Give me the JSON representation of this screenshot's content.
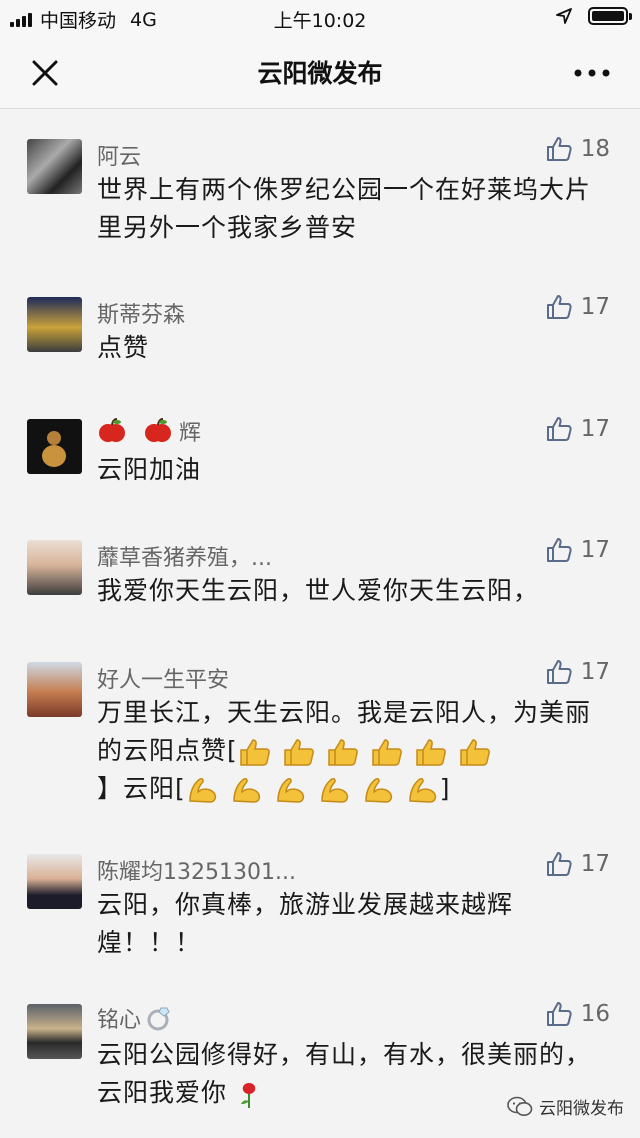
{
  "status_bar": {
    "carrier": "中国移动",
    "network": "4G",
    "time": "上午10:02"
  },
  "nav": {
    "title": "云阳微发布"
  },
  "comments": [
    {
      "name": "阿云",
      "likes": "18",
      "text": "世界上有两个侏罗纪公园一个在好莱坞大片里另外一个我家乡普安"
    },
    {
      "name": "斯蒂芬森",
      "likes": "17",
      "text": "点赞"
    },
    {
      "name": "辉",
      "likes": "17",
      "text": "云阳加油"
    },
    {
      "name": "蘼草香猪养殖，...",
      "likes": "17",
      "text": "我爱你天生云阳，世人爱你天生云阳，"
    },
    {
      "name": "好人一生平安",
      "likes": "17",
      "text_part1": "万里长江，天生云阳。我是云阳人，为美丽的云阳点赞[",
      "text_part2": "】云阳[",
      "text_part3": "]"
    },
    {
      "name": "陈耀均13251301...",
      "likes": "17",
      "text": "云阳，你真棒，旅游业发展越来越辉煌！！！"
    },
    {
      "name": "铭心",
      "likes": "16",
      "text": "云阳公园修得好，有山，有水，很美丽的，云阳我爱你"
    }
  ],
  "watermark": {
    "label": "云阳微发布"
  }
}
